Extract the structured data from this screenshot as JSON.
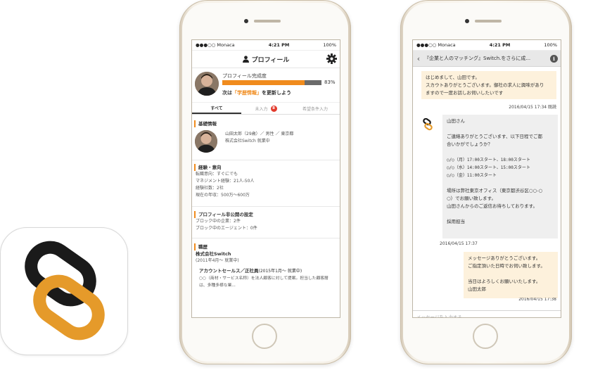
{
  "status_bar": {
    "carrier": "●●●○○ Monaca",
    "time": "4:21 PM",
    "battery": "100%"
  },
  "profile_screen": {
    "nav_title": "プロフィール",
    "completion_label": "プロフィール完成度",
    "completion_percent": 83,
    "completion_percent_text": "83%",
    "update_prefix": "次は",
    "update_highlight": "「学歴情報」",
    "update_suffix": "を更新しよう",
    "tabs": [
      {
        "label": "すべて",
        "active": true
      },
      {
        "label": "未入力",
        "badge": "8"
      },
      {
        "label": "希望条件入力"
      }
    ],
    "basic": {
      "title": "基礎情報",
      "line1": "山田太郎（29歳）／ 男性 ／ 東京都",
      "line2": "株式会社Switch 就業中"
    },
    "experience": {
      "title": "経験・意向",
      "lines": [
        "転職意向：すぐにでも",
        "マネジメント経験：21人-50人",
        "経験社数：2社",
        "現在の年収：500万〜600万"
      ]
    },
    "privacy": {
      "title": "プロフィール非公開の設定",
      "lines": [
        "ブロック中の企業：2件",
        "ブロック中のエージェント：0件"
      ]
    },
    "career": {
      "title": "職歴",
      "company": "株式会社Switch",
      "period": "(2011年4月〜 就業中)",
      "position": "アカウントセールス／正社員",
      "position_period": "(2015年1月〜 就業中)",
      "desc1": "○○（商材・サービス名称）を法人顧客に対して提案。担当した顧客層",
      "desc2": "は、多種多様な業..."
    }
  },
  "chat_screen": {
    "nav_title": "『企業と人のマッチング』Switch.をさらに成...",
    "msg1": [
      "はじめまして、山田です。",
      "スカウトありがとうございます。御社の求人に興味があり",
      "ますので一度お話しお伺いしたいです"
    ],
    "msg1_time": "2016/04/15 17:34 既読",
    "msg2": [
      "山田さん",
      "",
      "ご連絡ありがとうございます、以下日程でご都",
      "合いかがでしょうか？",
      "",
      "○/○（月）17:00スタート、18:00スタート",
      "○/○（水）14:00スタート、15:00スタート",
      "○/○（金）11:00スタート",
      "",
      "場所は弊社東京オフィス（東京都渋谷区○○-○",
      "○）でお願い致します。",
      "山田さんからのご返信お待ちしております。",
      "",
      "採用担当"
    ],
    "msg2_time": "2016/04/15 17:37",
    "msg3": [
      "メッセージありがとうございます。",
      "ご指定頂いた日時でお伺い致します。",
      "",
      "当日はよろしくお願いいたします。",
      "山田太郎"
    ],
    "msg3_time": "2016/04/15 17:38",
    "input_placeholder": "メッセージを入力する"
  },
  "colors": {
    "accent": "#f08b1d",
    "logo_dark": "#1a1a1a",
    "logo_orange": "#e59a2a"
  }
}
